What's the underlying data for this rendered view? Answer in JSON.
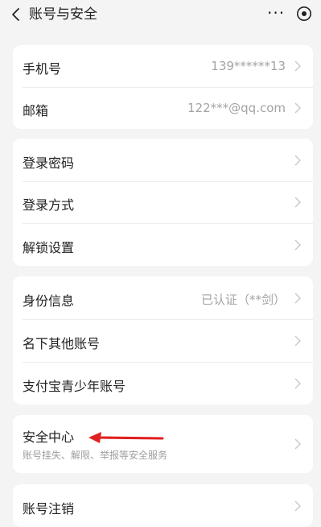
{
  "header": {
    "title": "账号与安全",
    "more": "···"
  },
  "contact": {
    "phone_label": "手机号",
    "phone_value": "139******13",
    "email_label": "邮箱",
    "email_value": "122***@qq.com"
  },
  "login": {
    "password_label": "登录密码",
    "method_label": "登录方式",
    "unlock_label": "解锁设置"
  },
  "identity": {
    "info_label": "身份信息",
    "info_value": "已认证（**剑）",
    "other_accounts_label": "名下其他账号",
    "youth_label": "支付宝青少年账号"
  },
  "security": {
    "center_label": "安全中心",
    "center_sub": "账号挂失、解限、举报等安全服务"
  },
  "cancel": {
    "label": "账号注销"
  },
  "colors": {
    "background": "#f4f4f4",
    "card": "#ffffff",
    "annotation_arrow": "#e02020"
  }
}
